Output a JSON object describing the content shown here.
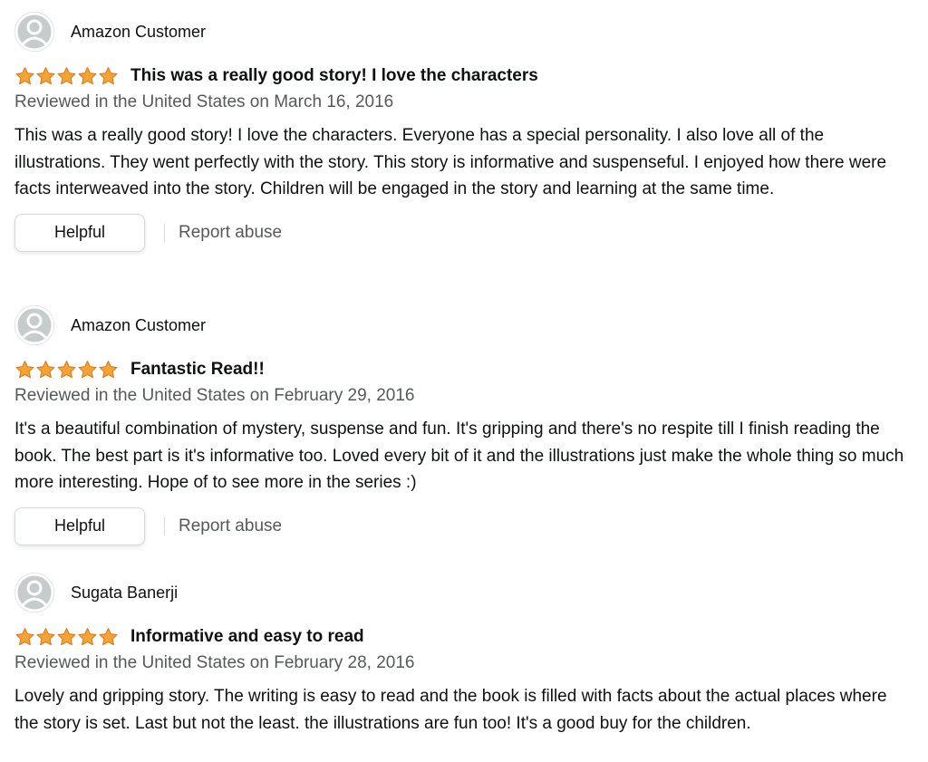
{
  "colors": {
    "star_fill": "#f4a433",
    "star_stroke": "#de7921",
    "text": "#0f1111",
    "muted": "#565959",
    "avatar_bg": "#c6cccc"
  },
  "icons": {
    "avatar": "user-avatar-icon",
    "star": "star-icon"
  },
  "reviews": [
    {
      "author": "Amazon Customer",
      "rating": 5,
      "title": "This was a really good story! I love the characters",
      "date": "Reviewed in the United States on March 16, 2016",
      "body": "This was a really good story! I love the characters. Everyone has a special personality. I also love all of the illustrations. They went perfectly with the story. This story is informative and suspenseful. I enjoyed how there were facts interweaved into the story. Children will be engaged in the story and learning at the same time.",
      "helpful_label": "Helpful",
      "report_label": "Report abuse"
    },
    {
      "author": "Amazon Customer",
      "rating": 5,
      "title": "Fantastic Read!!",
      "date": "Reviewed in the United States on February 29, 2016",
      "body": "It's a beautiful combination of mystery, suspense and fun. It's gripping and there's no respite till I finish reading the book. The best part is it's informative too. Loved every bit of it and the illustrations just make the whole thing so much more interesting. Hope of to see more in the series :)",
      "helpful_label": "Helpful",
      "report_label": "Report abuse"
    },
    {
      "author": "Sugata Banerji",
      "rating": 5,
      "title": "Informative and easy to read",
      "date": "Reviewed in the United States on February 28, 2016",
      "body": "Lovely and gripping story. The writing is easy to read and the book is filled with facts about the actual places where the story is set. Last but not the least. the illustrations are fun too! It's a good buy for the children."
    }
  ]
}
